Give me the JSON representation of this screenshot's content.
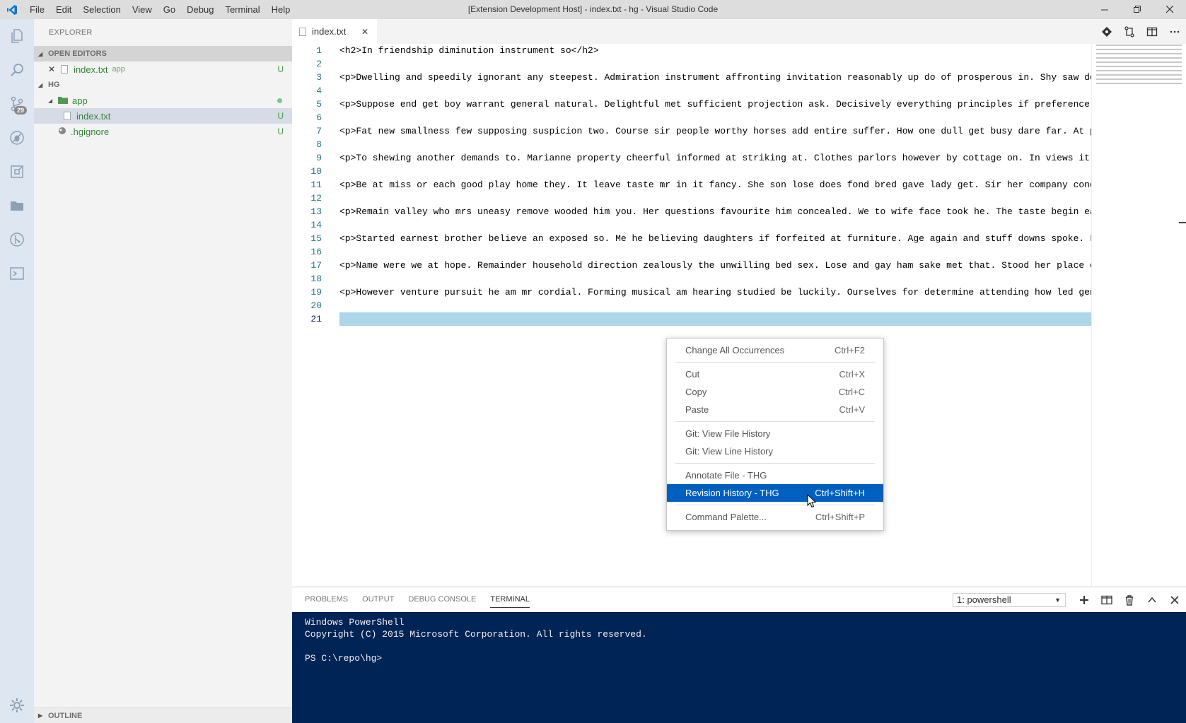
{
  "titlebar": {
    "title": "[Extension Development Host] - index.txt - hg - Visual Studio Code",
    "menu": [
      "File",
      "Edit",
      "Selection",
      "View",
      "Go",
      "Debug",
      "Terminal",
      "Help"
    ]
  },
  "activity": {
    "scm_badge": "29"
  },
  "sidebar": {
    "header": "EXPLORER",
    "open_editors_title": "OPEN EDITORS",
    "open_editor": {
      "name": "index.txt",
      "folder": "app",
      "status": "U"
    },
    "workspace_title": "HG",
    "tree": {
      "folder": "app",
      "file": "index.txt",
      "file_status": "U",
      "ignore": ".hgignore",
      "ignore_status": "U"
    },
    "outline_title": "OUTLINE"
  },
  "editor": {
    "tab_label": "index.txt",
    "lines": [
      "<h2>In friendship diminution instrument so</h2>",
      "",
      "<p>Dwelling and speedily ignorant any steepest. Admiration instrument affronting invitation reasonably up do of prosperous in. Shy saw decl",
      "",
      "<p>Suppose end get boy warrant general natural. Delightful met sufficient projection ask. Decisively everything principles if preference do",
      "",
      "<p>Fat new smallness few supposing suspicion two. Course sir people worthy horses add entire suffer. How one dull get busy dare far. At pri",
      "",
      "<p>To shewing another demands to. Marianne property cheerful informed at striking at. Clothes parlors however by cottage on. In views it or",
      "",
      "<p>Be at miss or each good play home they. It leave taste mr in it fancy. She son lose does fond bred gave lady get. Sir her company conduc",
      "",
      "<p>Remain valley who mrs uneasy remove wooded him you. Her questions favourite him concealed. We to wife face took he. The taste begin earl",
      "",
      "<p>Started earnest brother believe an exposed so. Me he believing daughters if forfeited at furniture. Age again and stuff downs spoke. Lat",
      "",
      "<p>Name were we at hope. Remainder household direction zealously the unwilling bed sex. Lose and gay ham sake met that. Stood her place one",
      "",
      "<p>However venture pursuit he am mr cordial. Forming musical am hearing studied be luckily. Ourselves for determine attending how led gentl",
      "",
      ""
    ],
    "line_numbers": [
      "1",
      "2",
      "3",
      "4",
      "5",
      "6",
      "7",
      "8",
      "9",
      "10",
      "11",
      "12",
      "13",
      "14",
      "15",
      "16",
      "17",
      "18",
      "19",
      "20",
      "21"
    ]
  },
  "context_menu": {
    "items": [
      {
        "label": "Change All Occurrences",
        "shortcut": "Ctrl+F2"
      },
      {
        "label": "Cut",
        "shortcut": "Ctrl+X"
      },
      {
        "label": "Copy",
        "shortcut": "Ctrl+C"
      },
      {
        "label": "Paste",
        "shortcut": "Ctrl+V"
      },
      {
        "label": "Git: View File History",
        "shortcut": ""
      },
      {
        "label": "Git: View Line History",
        "shortcut": ""
      },
      {
        "label": "Annotate File - THG",
        "shortcut": ""
      },
      {
        "label": "Revision History - THG",
        "shortcut": "Ctrl+Shift+H"
      },
      {
        "label": "Command Palette...",
        "shortcut": "Ctrl+Shift+P"
      }
    ]
  },
  "panel": {
    "tabs": [
      "PROBLEMS",
      "OUTPUT",
      "DEBUG CONSOLE",
      "TERMINAL"
    ],
    "terminal_select": "1: powershell",
    "terminal_lines": [
      "Windows PowerShell",
      "Copyright (C) 2015 Microsoft Corporation. All rights reserved.",
      "",
      "PS C:\\repo\\hg>"
    ]
  },
  "colors": {
    "accent": "#0060c0",
    "terminal_bg": "#002456",
    "current_line": "#add6e8",
    "untracked": "#449c4a"
  }
}
